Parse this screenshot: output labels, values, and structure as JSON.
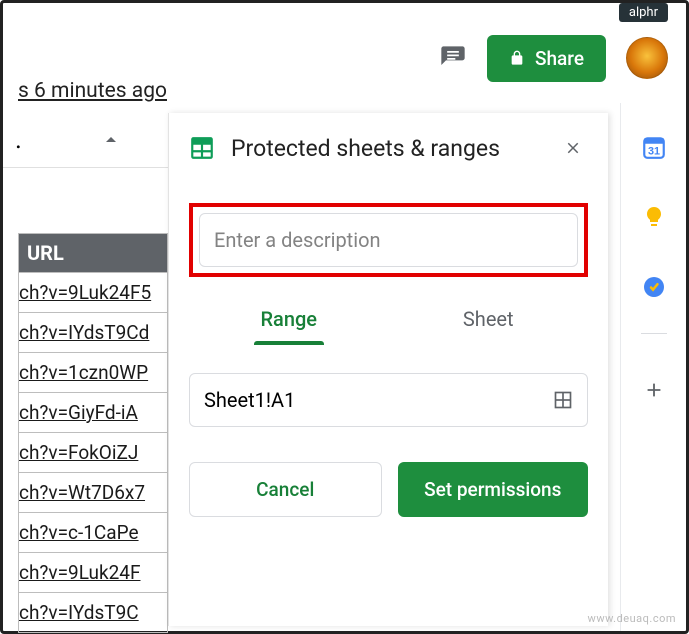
{
  "top_tag": "alphr",
  "header": {
    "timestamp": "s 6 minutes ago",
    "share_label": "Share"
  },
  "toolbar": {
    "menu_char": ".",
    "chevron": "collapse"
  },
  "sheet": {
    "column_header": "URL",
    "rows": [
      "ch?v=9Luk24F5",
      "ch?v=IYdsT9Cd",
      "ch?v=1czn0WP",
      "ch?v=GiyFd-iA",
      "ch?v=FokOiZJ",
      "ch?v=Wt7D6x7",
      "ch?v=c-1CaPe",
      "ch?v=9Luk24F",
      "ch?v=IYdsT9C"
    ]
  },
  "panel": {
    "title": "Protected sheets & ranges",
    "description_placeholder": "Enter a description",
    "tab_range": "Range",
    "tab_sheet": "Sheet",
    "range_value": "Sheet1!A1",
    "cancel_label": "Cancel",
    "set_permissions_label": "Set permissions"
  },
  "rail": {
    "calendar": "calendar-icon",
    "keep": "keep-icon",
    "tasks": "tasks-icon",
    "add": "add-icon"
  },
  "watermark": "www.deuaq.com"
}
